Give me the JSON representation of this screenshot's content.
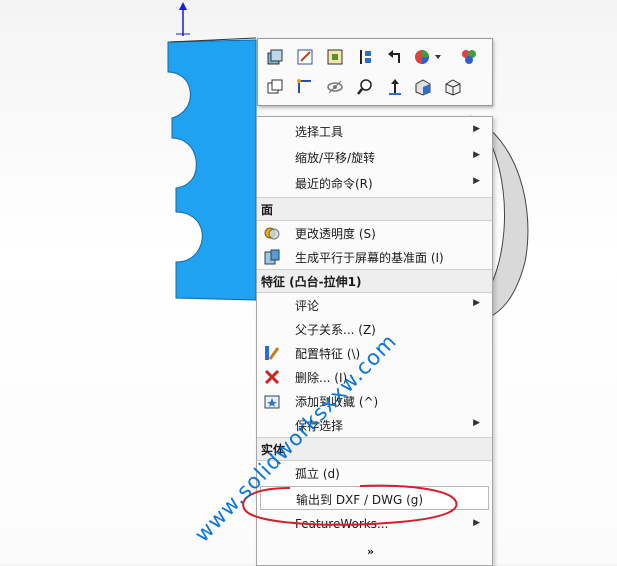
{
  "toolbar": {
    "icons": [
      "zoom-to-fit-icon",
      "sketch-icon",
      "view-orientation-icon",
      "section-view-icon",
      "undo-arrow-icon",
      "appearance-icon",
      "scene-icon",
      "copy-icon",
      "smart-dimension-icon",
      "hide-show-icon",
      "zoom-area-icon",
      "normal-to-icon",
      "iso-view-icon",
      "view-cube-icon"
    ]
  },
  "menu": {
    "items": {
      "select_tools": "选择工具",
      "zoom_pan_rotate": "缩放/平移/旋转",
      "recent_commands": "最近的命令(R)",
      "section_face": "面",
      "change_transparency": "更改透明度 (S)",
      "create_plane": "生成平行于屏幕的基准面 (I)",
      "section_feature": "特征 (凸台-拉伸1)",
      "comment": "评论",
      "parent_child": "父子关系... (Z)",
      "configure_feature": "配置特征 (\\)",
      "delete": "删除... (I)",
      "add_to_favorites": "添加到收藏 (^)",
      "save_selection": "保存选择",
      "section_body": "实体",
      "isolate": "孤立 (d)",
      "export_dxf": "输出到 DXF / DWG (g)",
      "featureworks": "FeatureWorks...",
      "more": "»"
    }
  },
  "watermark": "www.solidworksxxw.com",
  "colors": {
    "part_blue": "#1fa3f0",
    "watermark": "#0a75d6",
    "annotation_red": "#d41f2c"
  }
}
